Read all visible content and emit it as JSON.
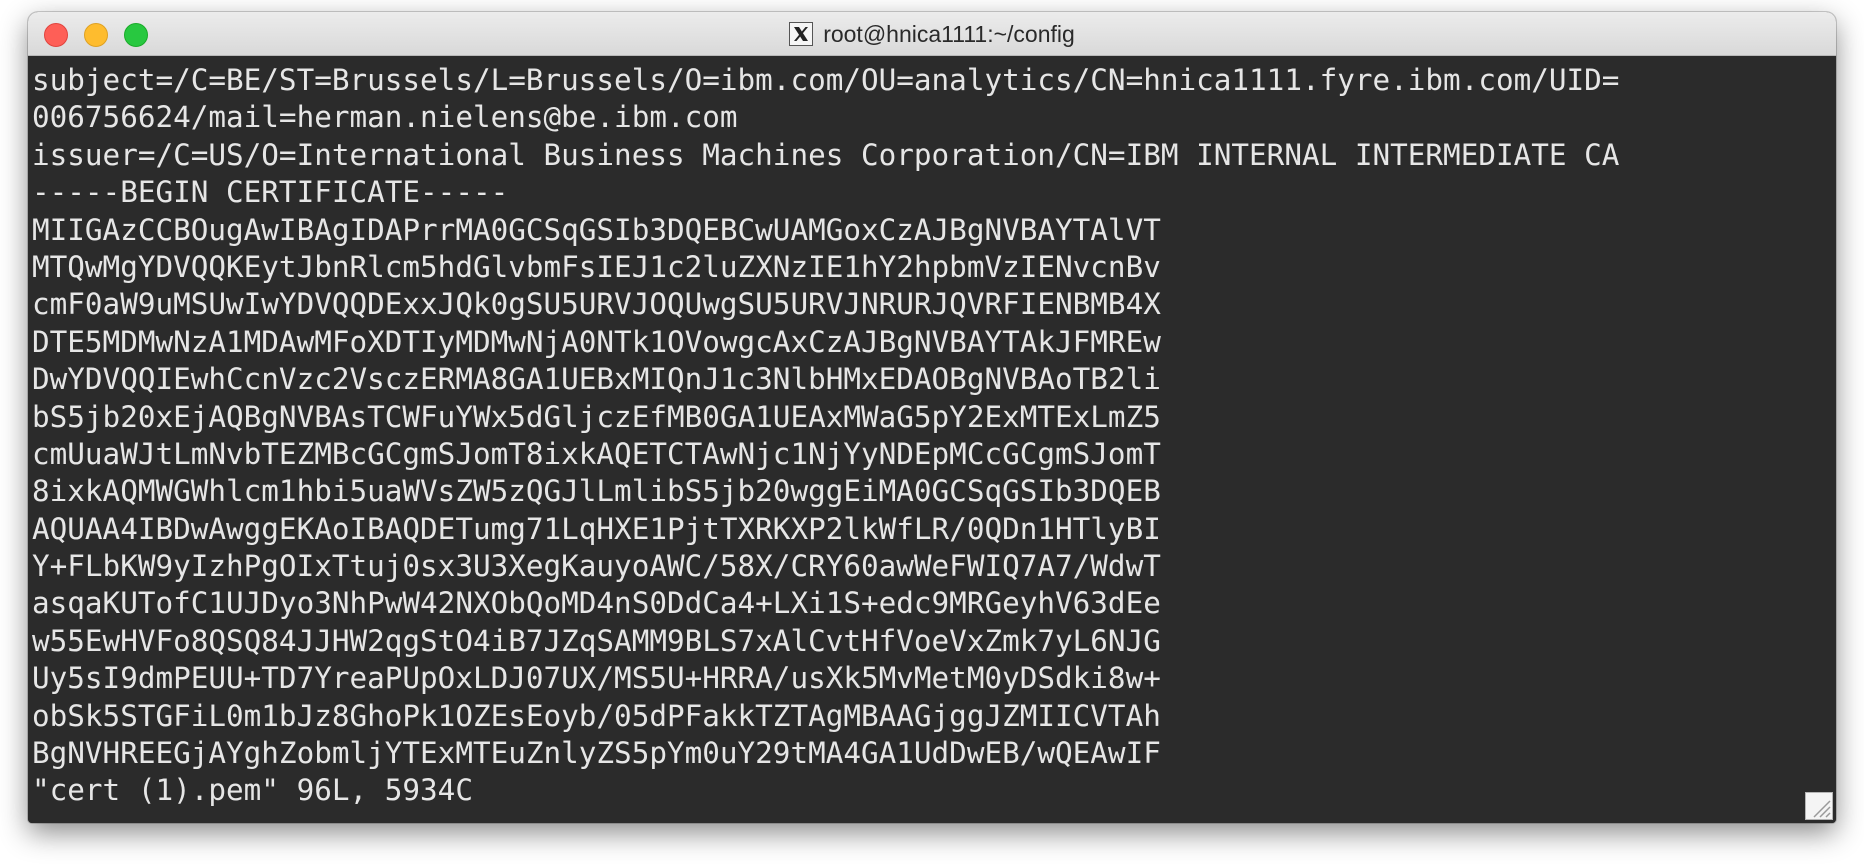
{
  "window": {
    "title": "root@hnica1111:~/config"
  },
  "icons": {
    "app_icon": "x11-icon",
    "resize": "resize-grip-icon"
  },
  "colors": {
    "terminal_bg": "#2b2b2b",
    "terminal_fg": "#e6e6e6",
    "close": "#fe5f57",
    "minimize": "#febc2e",
    "zoom": "#28c840"
  },
  "terminal": {
    "lines": [
      "subject=/C=BE/ST=Brussels/L=Brussels/O=ibm.com/OU=analytics/CN=hnica1111.fyre.ibm.com/UID=",
      "006756624/mail=herman.nielens@be.ibm.com",
      "issuer=/C=US/O=International Business Machines Corporation/CN=IBM INTERNAL INTERMEDIATE CA",
      "-----BEGIN CERTIFICATE-----",
      "MIIGAzCCBOugAwIBAgIDAPrrMA0GCSqGSIb3DQEBCwUAMGoxCzAJBgNVBAYTAlVT",
      "MTQwMgYDVQQKEytJbnRlcm5hdGlvbmFsIEJ1c2luZXNzIE1hY2hpbmVzIENvcnBv",
      "cmF0aW9uMSUwIwYDVQQDExxJQk0gSU5URVJOQUwgSU5URVJNRURJQVRFIENBMB4X",
      "DTE5MDMwNzA1MDAwMFoXDTIyMDMwNjA0NTk1OVowgcAxCzAJBgNVBAYTAkJFMREw",
      "DwYDVQQIEwhCcnVzc2VsczERMA8GA1UEBxMIQnJ1c3NlbHMxEDAOBgNVBAoTB2li",
      "bS5jb20xEjAQBgNVBAsTCWFuYWx5dGljczEfMB0GA1UEAxMWaG5pY2ExMTExLmZ5",
      "cmUuaWJtLmNvbTEZMBcGCgmSJomT8ixkAQETCTAwNjc1NjYyNDEpMCcGCgmSJomT",
      "8ixkAQMWGWhlcm1hbi5uaWVsZW5zQGJlLmlibS5jb20wggEiMA0GCSqGSIb3DQEB",
      "AQUAA4IBDwAwggEKAoIBAQDETumg71LqHXE1PjtTXRKXP2lkWfLR/0QDn1HTlyBI",
      "Y+FLbKW9yIzhPgOIxTtuj0sx3U3XegKauyoAWC/58X/CRY60awWeFWIQ7A7/WdwT",
      "asqaKUTofC1UJDyo3NhPwW42NXObQoMD4nS0DdCa4+LXi1S+edc9MRGeyhV63dEe",
      "w55EwHVFo8QSQ84JJHW2qgStO4iB7JZqSAMM9BLS7xAlCvtHfVoeVxZmk7yL6NJG",
      "Uy5sI9dmPEUU+TD7YreaPUpOxLDJ07UX/MS5U+HRRA/usXk5MvMetM0yDSdki8w+",
      "obSk5STGFiL0m1bJz8GhoPk1OZEsEoyb/05dPFakkTZTAgMBAAGjggJZMIICVTAh",
      "BgNVHREEGjAYghZobmljYTExMTEuZnlyZS5pYm0uY29tMA4GA1UdDwEB/wQEAwIF",
      "\"cert (1).pem\" 96L, 5934C"
    ]
  }
}
